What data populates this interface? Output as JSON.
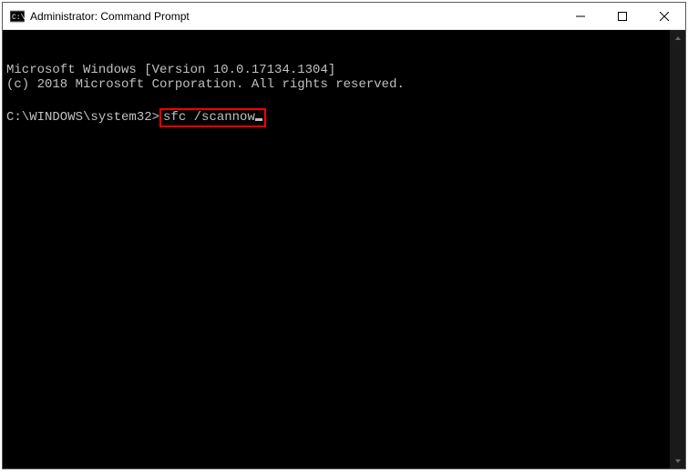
{
  "titlebar": {
    "title": "Administrator: Command Prompt"
  },
  "terminal": {
    "line1": "Microsoft Windows [Version 10.0.17134.1304]",
    "line2": "(c) 2018 Microsoft Corporation. All rights reserved.",
    "prompt_path": "C:\\WINDOWS\\system32>",
    "command": "sfc /scannow"
  }
}
